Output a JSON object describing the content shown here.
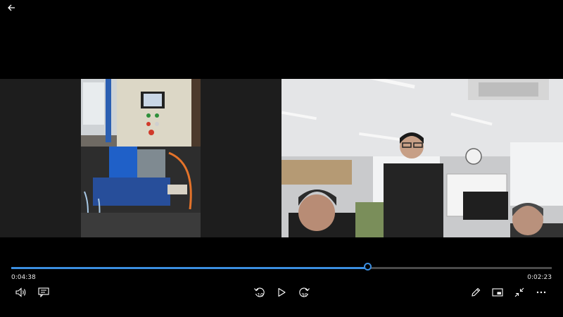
{
  "player": {
    "elapsed": "0:04:38",
    "remaining": "0:02:23",
    "progress_percent": 66,
    "skip_back_seconds": "10",
    "skip_forward_seconds": "30"
  },
  "icons": {
    "back": "arrow-left-icon",
    "volume": "speaker-icon",
    "captions": "captions-icon",
    "skip_back": "skip-back-10-icon",
    "play": "play-icon",
    "skip_forward": "skip-forward-30-icon",
    "edit": "pencil-icon",
    "miniview": "mini-view-icon",
    "exit_fullscreen": "exit-fullscreen-icon",
    "more": "more-icon"
  },
  "colors": {
    "accent": "#3b8ee0",
    "background": "#000000"
  }
}
